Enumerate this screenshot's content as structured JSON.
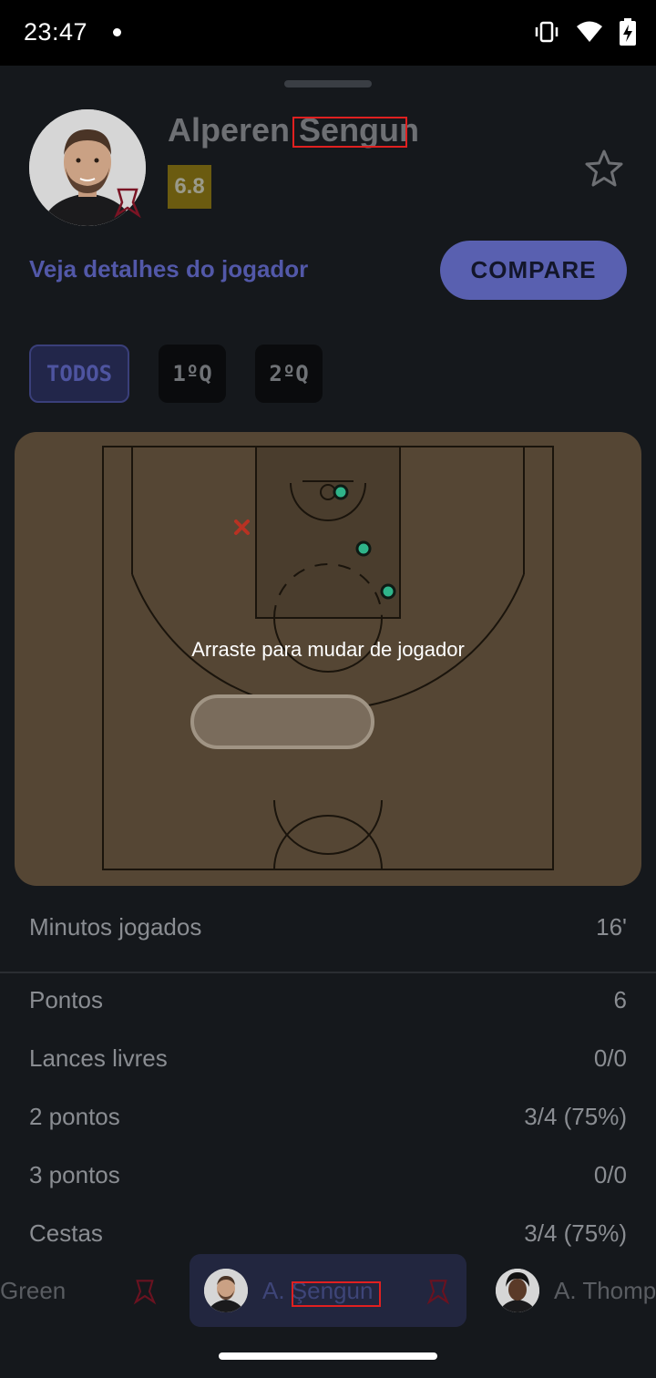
{
  "status_bar": {
    "time": "23:47"
  },
  "player": {
    "name": "Alperen Sengun",
    "rating": "6.8",
    "details_link": "Veja detalhes do jogador",
    "compare_label": "COMPARE"
  },
  "filters": [
    "TODOS",
    "1ºQ",
    "2ºQ"
  ],
  "court": {
    "hint": "Arraste para mudar de jogador",
    "shots": [
      {
        "result": "made"
      },
      {
        "result": "made"
      },
      {
        "result": "made"
      },
      {
        "result": "missed"
      }
    ]
  },
  "stats": [
    {
      "label": "Minutos jogados",
      "value": "16'"
    },
    {
      "label": "Pontos",
      "value": "6"
    },
    {
      "label": "Lances livres",
      "value": "0/0"
    },
    {
      "label": "2 pontos",
      "value": "3/4 (75%)"
    },
    {
      "label": "3 pontos",
      "value": "0/0"
    },
    {
      "label": "Cestas",
      "value": "3/4 (75%)"
    }
  ],
  "player_tabs": [
    "Green",
    "A. Şengun",
    "A. Thomp"
  ],
  "colors": {
    "accent": "#5960b0",
    "made": "#2fb58a",
    "missed": "#c0392b",
    "rating": "#6b5b10"
  }
}
